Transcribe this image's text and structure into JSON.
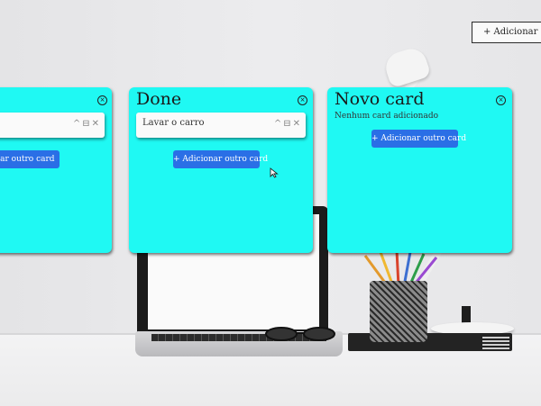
{
  "header": {
    "add_card_label": "+  Adicionar Card"
  },
  "columns": [
    {
      "title": "",
      "task": "",
      "add_label": "+ Adicionar outro card"
    },
    {
      "title": "Done",
      "task": "Lavar o carro",
      "add_label": "+ Adicionar outro card"
    },
    {
      "title": "Novo card",
      "empty_message": "Nenhum card adicionado",
      "add_label": "+ Adicionar outro card"
    }
  ],
  "icons": {
    "close": "circle-x-icon",
    "task_controls": [
      "chevron-up-icon",
      "collapse-icon",
      "close-x-icon"
    ]
  },
  "colors": {
    "column_bg": "#1ff9f3",
    "button_bg": "#2a6fe6"
  }
}
